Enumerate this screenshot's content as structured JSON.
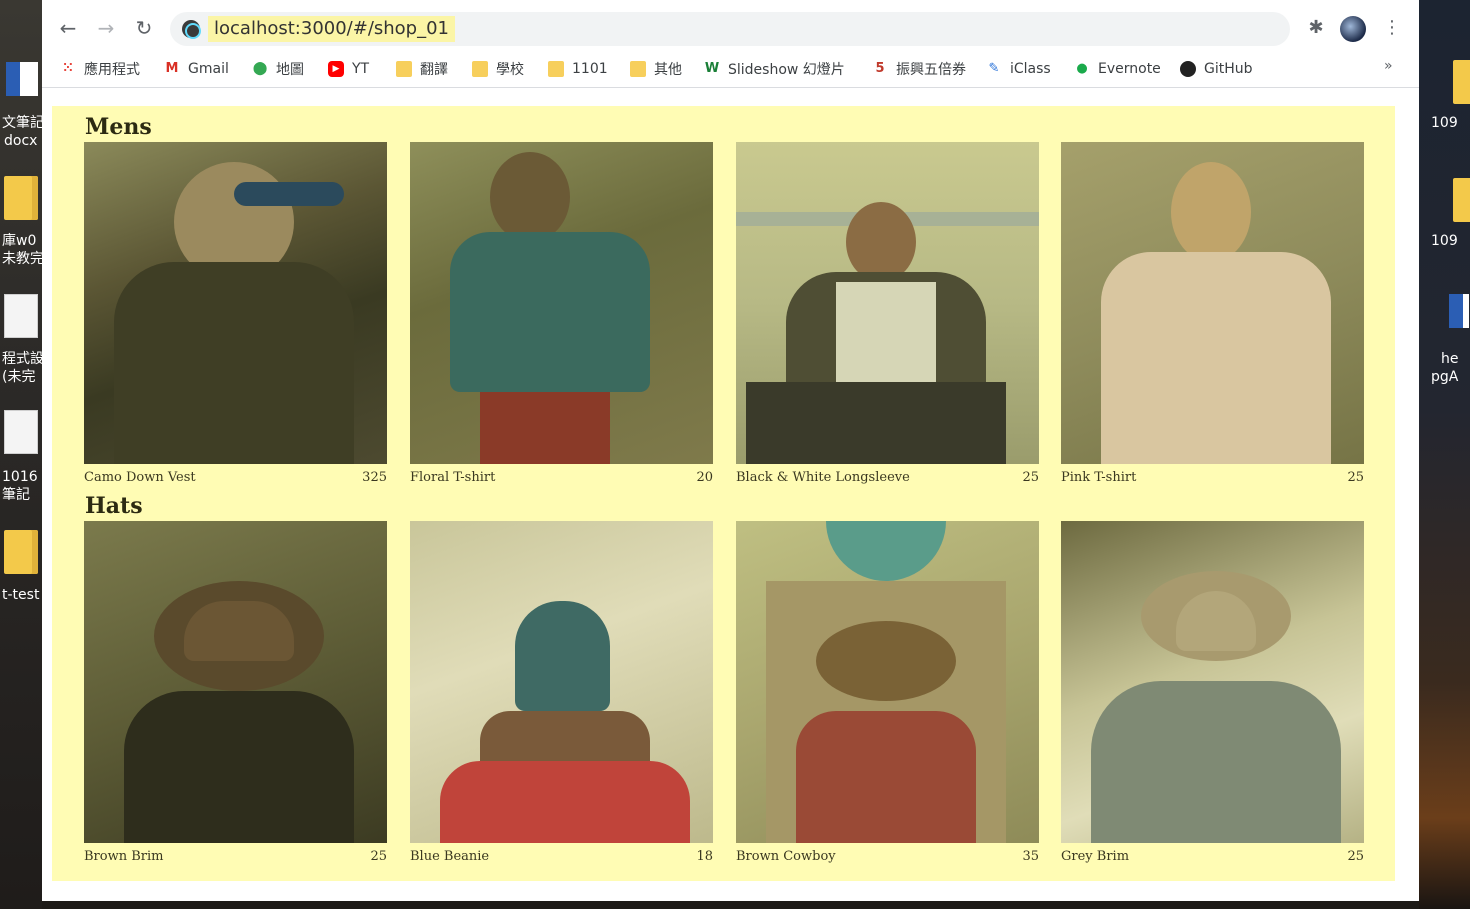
{
  "desktop": {
    "left_items": [
      "文筆記",
      "docx",
      "庫w0",
      "未教完",
      "程式設",
      "(未完",
      "1016",
      "筆記",
      "t-test"
    ],
    "right_items": [
      "109",
      "109",
      "he",
      "pgA"
    ]
  },
  "browser": {
    "url": "localhost:3000/#/shop_01",
    "bookmarks": [
      {
        "label": "應用程式",
        "icon": "apps-grid-icon"
      },
      {
        "label": "Gmail",
        "icon": "gmail-icon"
      },
      {
        "label": "地圖",
        "icon": "maps-pin-icon"
      },
      {
        "label": "YT",
        "icon": "youtube-icon"
      },
      {
        "label": "翻譯",
        "icon": "folder-icon"
      },
      {
        "label": "學校",
        "icon": "folder-icon"
      },
      {
        "label": "1101",
        "icon": "folder-icon"
      },
      {
        "label": "其他",
        "icon": "folder-icon"
      },
      {
        "label": "Slideshow 幻燈片",
        "icon": "w-logo-icon"
      },
      {
        "label": "振興五倍券",
        "icon": "five-logo-icon"
      },
      {
        "label": "iClass",
        "icon": "iclass-icon"
      },
      {
        "label": "Evernote",
        "icon": "evernote-icon"
      },
      {
        "label": "GitHub",
        "icon": "github-icon"
      }
    ],
    "more_label": "»"
  },
  "shop": {
    "sections": [
      {
        "title": "Mens",
        "items": [
          {
            "name": "Camo Down Vest",
            "price": "325"
          },
          {
            "name": "Floral T-shirt",
            "price": "20"
          },
          {
            "name": "Black & White Longsleeve",
            "price": "25"
          },
          {
            "name": "Pink T-shirt",
            "price": "25"
          }
        ]
      },
      {
        "title": "Hats",
        "items": [
          {
            "name": "Brown Brim",
            "price": "25"
          },
          {
            "name": "Blue Beanie",
            "price": "18"
          },
          {
            "name": "Brown Cowboy",
            "price": "35"
          },
          {
            "name": "Grey Brim",
            "price": "25"
          }
        ]
      }
    ]
  },
  "colors": {
    "page_background": "#fffcb4",
    "url_highlight": "#fbf5a6"
  }
}
